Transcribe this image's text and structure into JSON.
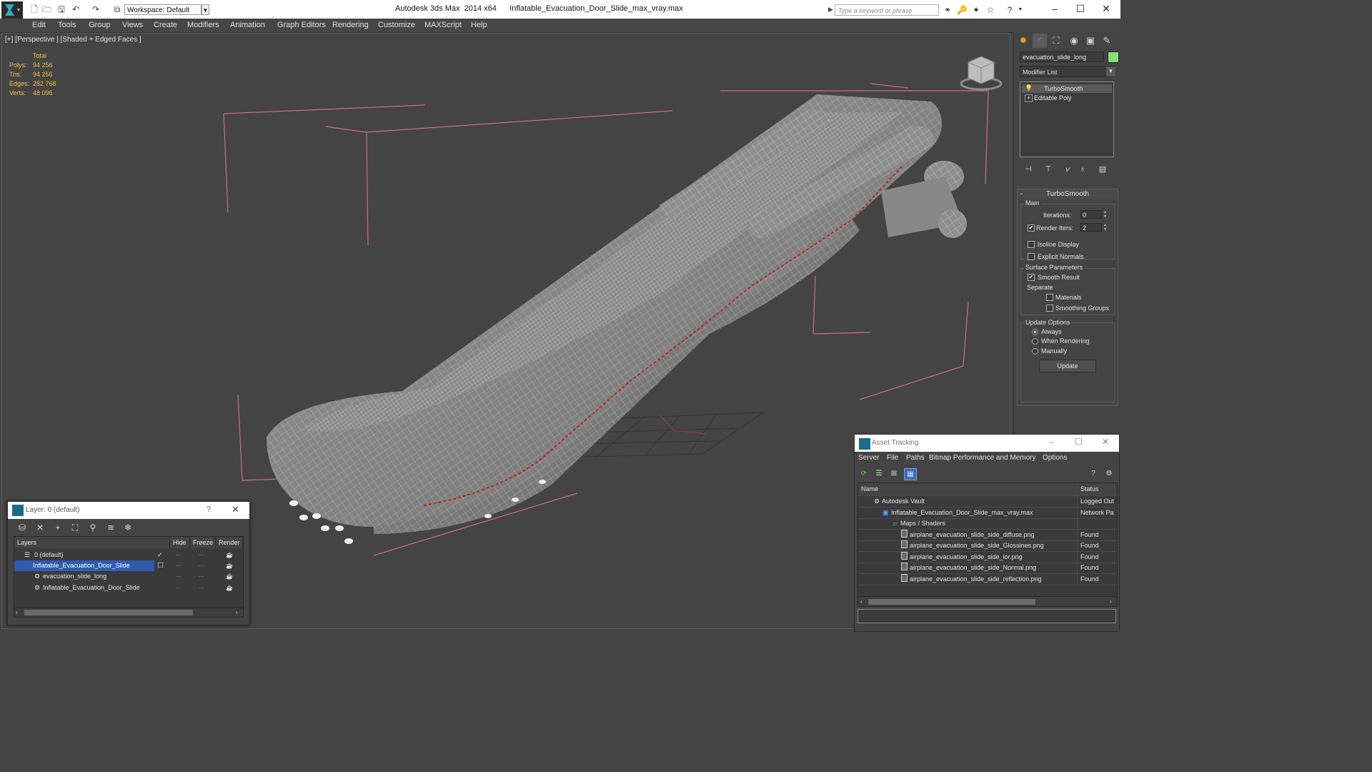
{
  "titlebar": {
    "title": "Autodesk 3ds Max  2014 x64      Inflatable_Evacuation_Door_Slide_max_vray.max",
    "workspace": "Workspace: Default",
    "search_placeholder": "Type a keyword or phrase"
  },
  "menu": [
    "Edit",
    "Tools",
    "Group",
    "Views",
    "Create",
    "Modifiers",
    "Animation",
    "Graph Editors",
    "Rendering",
    "Customize",
    "MAXScript",
    "Help"
  ],
  "viewport": {
    "label": "[+] [Perspective ] [Shaded + Edged Faces ]",
    "stats_header": "Total",
    "stats": [
      {
        "label": "Polys:",
        "value": "94 256"
      },
      {
        "label": "Tris:",
        "value": "94 256"
      },
      {
        "label": "Edges:",
        "value": "282 768"
      },
      {
        "label": "Verts:",
        "value": "48 096"
      }
    ]
  },
  "command_panel": {
    "object_name": "evacuation_slide_long",
    "object_color": "#86e07a",
    "modifier_list": "Modifier List",
    "stack": [
      "TurboSmooth",
      "Editable Poly"
    ],
    "turbosmooth": {
      "title": "TurboSmooth",
      "main": "Main",
      "iterations_label": "Iterations:",
      "iterations": "0",
      "render_iters_label": "Render Iters:",
      "render_iters": "2",
      "render_iters_checked": true,
      "isoline_display": "Isoline Display",
      "explicit_normals": "Explicit Normals",
      "surface_parameters": "Surface Parameters",
      "smooth_result": "Smooth Result",
      "separate": "Separate",
      "materials": "Materials",
      "smoothing_groups": "Smoothing Groups",
      "update_options": "Update Options",
      "always": "Always",
      "when_rendering": "When Rendering",
      "manually": "Manually",
      "update": "Update"
    }
  },
  "layer_dialog": {
    "title": "Layer: 0 (default)",
    "help": "?",
    "columns": [
      "Layers",
      "Hide",
      "Freeze",
      "Render"
    ],
    "rows": [
      {
        "name": "0 (default)",
        "selected": false
      },
      {
        "name": "Inflatable_Evacuation_Door_Slide",
        "selected": true
      },
      {
        "name": "evacuation_slide_long",
        "selected": false
      },
      {
        "name": "Inflatable_Evacuation_Door_Slide",
        "selected": false
      }
    ]
  },
  "asset_tracking": {
    "title": "Asset Tracking",
    "menu": [
      "Server",
      "File",
      "Paths",
      "Bitmap Performance and Memory",
      "Options"
    ],
    "columns": [
      "Name",
      "Status"
    ],
    "rows": [
      {
        "name": "Autodesk Vault",
        "status": "Logged Out"
      },
      {
        "name": "Inflatable_Evacuation_Door_Slide_max_vray.max",
        "status": "Network Pa"
      },
      {
        "name": "Maps / Shaders",
        "status": ""
      },
      {
        "name": "airplane_evacuation_slide_side_diffuse.png",
        "status": "Found"
      },
      {
        "name": "airplane_evacuation_slide_side_Glossines.png",
        "status": "Found"
      },
      {
        "name": "airplane_evacuation_slide_side_ior.png",
        "status": "Found"
      },
      {
        "name": "airplane_evacuation_slide_side_Normal.png",
        "status": "Found"
      },
      {
        "name": "airplane_evacuation_slide_side_reflection.png",
        "status": "Found"
      }
    ]
  }
}
